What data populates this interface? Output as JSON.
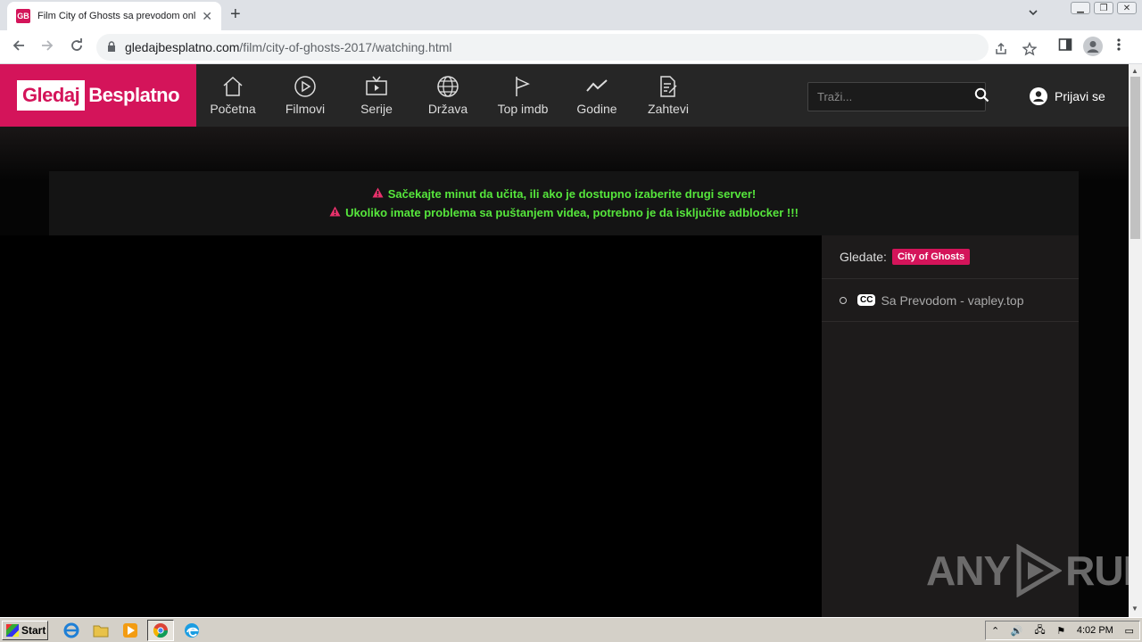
{
  "browser": {
    "tab_title": "Film City of Ghosts sa prevodom onli",
    "tab_favicon": "GB",
    "tab_close": "✕",
    "new_tab": "+",
    "url_host": "gledajbesplatno.com",
    "url_path": "/film/city-of-ghosts-2017/watching.html"
  },
  "site": {
    "logo_part1": "Gledaj",
    "logo_part2": "Besplatno",
    "menu": [
      {
        "label": "Početna",
        "icon": "home-icon"
      },
      {
        "label": "Filmovi",
        "icon": "play-circle-icon"
      },
      {
        "label": "Serije",
        "icon": "tv-icon"
      },
      {
        "label": "Država",
        "icon": "globe-icon"
      },
      {
        "label": "Top imdb",
        "icon": "flag-icon"
      },
      {
        "label": "Godine",
        "icon": "trend-icon"
      },
      {
        "label": "Zahtevi",
        "icon": "document-edit-icon"
      }
    ],
    "search_placeholder": "Traži...",
    "login_label": "Prijavi se"
  },
  "notice": {
    "line1": "Sačekajte minut da učita, ili ako je dostupno izaberite drugi server!",
    "line2": "Ukoliko imate problema sa puštanjem videa, potrebno je da isključite adblocker !!!"
  },
  "sidebar": {
    "watching_label": "Gledate:",
    "watching_title": "City of Ghosts",
    "server_badge": "CC",
    "server_label": "Sa Prevodom - vapley.top"
  },
  "watermark": {
    "left": "ANY",
    "right": "RUN"
  },
  "taskbar": {
    "start_label": "Start",
    "clock": "4:02 PM"
  },
  "colors": {
    "brand": "#d4145a",
    "notice_text": "#56e63c",
    "header_bg": "#262626"
  }
}
